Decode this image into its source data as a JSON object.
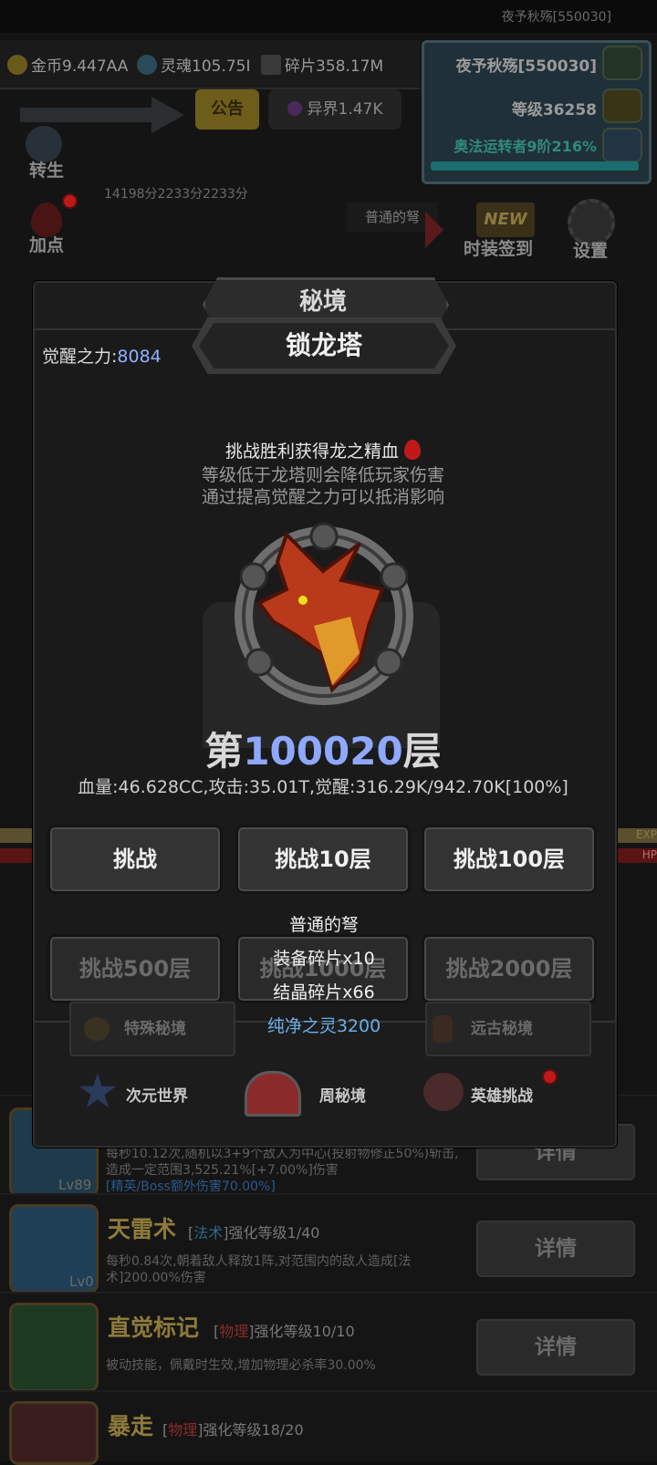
{
  "top": {
    "player_name": "夜予秋殇[550030]"
  },
  "resources": {
    "gold": "金币9.447AA",
    "soul": "灵魂105.75I",
    "fragment": "碎片358.17M",
    "otherworld": "异界1.47K"
  },
  "player_panel": {
    "name": "夜予秋殇[550030]",
    "level": "等级36258",
    "class": "奥法运转者9阶216%"
  },
  "notice_label": "公告",
  "left_menu": {
    "rebirth": "转生",
    "add_points": "加点"
  },
  "timers": "14198分2233分2233分",
  "bow_label": "普通的弩",
  "right_menu": {
    "fashion": "时装签到",
    "settings": "设置",
    "new_badge": "NEW"
  },
  "modal": {
    "title": "秘境",
    "subtitle": "锁龙塔",
    "awaken_label": "觉醒之力:",
    "awaken_value": "8084",
    "info_line1": "挑战胜利获得龙之精血",
    "info_line2": "等级低于龙塔则会降低玩家伤害",
    "info_line3": "通过提高觉醒之力可以抵消影响",
    "floor_prefix": "第",
    "floor_number": "100020",
    "floor_suffix": "层",
    "stats": "血量:46.628CC,攻击:35.01T,觉醒:316.29K/942.70K[100%]",
    "buttons": [
      "挑战",
      "挑战10层",
      "挑战100层"
    ],
    "buttons_dim": [
      "挑战500层",
      "挑战1000层",
      "挑战2000层"
    ],
    "reward_tip": [
      "普通的弩",
      "装备碎片x10",
      "结晶碎片x66",
      "纯净之灵3200"
    ],
    "lower_buttons": [
      "特殊秘境",
      "远古秘境"
    ],
    "modes": [
      "次元世界",
      "周秘境",
      "英雄挑战"
    ]
  },
  "skills": [
    {
      "lv": "Lv89",
      "desc": "每秒10.12次,随机以3+9个敌人为中心(投射物修正50%)斩击,造成一定范围3,525.21%[+7.00%]伤害",
      "extra": "[精英/Boss额外伤害70.00%]",
      "detail": "详情"
    },
    {
      "name": "天雷术",
      "tag_pre": "[",
      "tag": "法术",
      "tag_post": "]强化等级1/40",
      "lv": "Lv0",
      "desc": "每秒0.84次,朝着敌人释放1阵,对范围内的敌人造成[法术]200.00%伤害",
      "detail": "详情"
    },
    {
      "name": "直觉标记",
      "tag_pre": "[",
      "tag": "物理",
      "tag_post": "]强化等级10/10",
      "desc": "被动技能，佩戴时生效,增加物理必杀率30.00%",
      "detail": "详情"
    },
    {
      "name": "暴走",
      "tag_pre": "[",
      "tag": "物理",
      "tag_post": "]强化等级18/20"
    }
  ],
  "bar_labels": {
    "exp": "EXP",
    "hp": "HP"
  },
  "colors": {
    "accent_blue": "#8fa8ff",
    "pure_blue": "#6aaee8",
    "title_gold": "#8e7a3a"
  }
}
